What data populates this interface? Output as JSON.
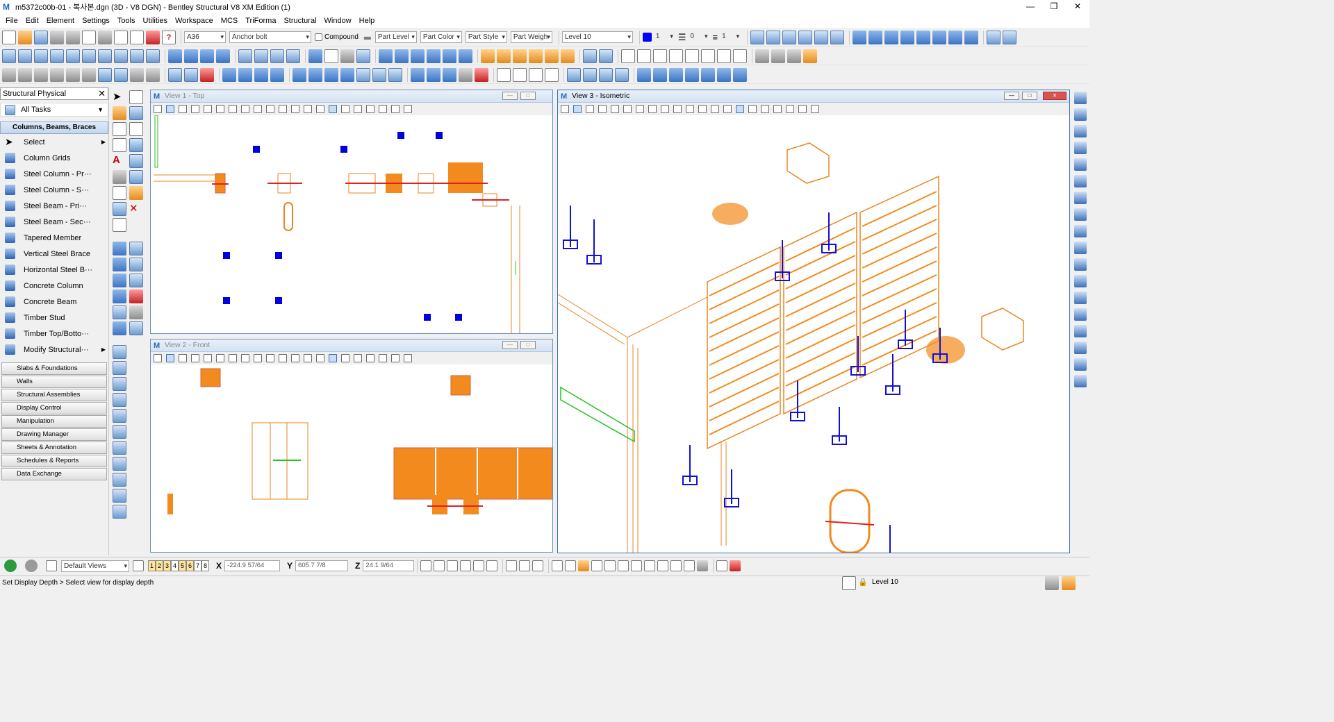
{
  "window": {
    "title": "m5372c00b-01 - 복사본.dgn (3D - V8 DGN) - Bentley Structural V8 XM Edition (1)",
    "app_icon_glyph": "M",
    "controls": [
      "—",
      "❐",
      "✕"
    ]
  },
  "menu": [
    "File",
    "Edit",
    "Element",
    "Settings",
    "Tools",
    "Utilities",
    "Workspace",
    "MCS",
    "TriForma",
    "Structural",
    "Window",
    "Help"
  ],
  "attributes_toolbar": {
    "material": "A36",
    "part": "Anchor bolt",
    "compound_label": "Compound",
    "part_level": "Part Level",
    "part_color": "Part Color",
    "part_style": "Part Style",
    "part_weight": "Part Weigh",
    "level": "Level 10",
    "color_value": "1",
    "style_value": "0",
    "weight_value": "1",
    "active_color": "#0000ff"
  },
  "task_panel": {
    "header": "Structural Physical",
    "close_glyph": "✕",
    "all_tasks": "All Tasks",
    "open_group": "Columns, Beams, Braces",
    "tools": [
      {
        "label": "Select",
        "icon": "arrow-select-icon"
      },
      {
        "label": "Column Grids",
        "icon": "column-grid-icon"
      },
      {
        "label": "Steel Column - Pr···",
        "icon": "steel-column-icon"
      },
      {
        "label": "Steel Column - S···",
        "icon": "steel-column-secondary-icon"
      },
      {
        "label": "Steel Beam - Pri···",
        "icon": "steel-beam-icon"
      },
      {
        "label": "Steel Beam - Sec···",
        "icon": "steel-beam-secondary-icon"
      },
      {
        "label": "Tapered Member",
        "icon": "tapered-member-icon"
      },
      {
        "label": "Vertical Steel Brace",
        "icon": "vertical-brace-icon"
      },
      {
        "label": "Horizontal Steel B···",
        "icon": "horizontal-brace-icon"
      },
      {
        "label": "Concrete Column",
        "icon": "concrete-column-icon"
      },
      {
        "label": "Concrete Beam",
        "icon": "concrete-beam-icon"
      },
      {
        "label": "Timber Stud",
        "icon": "timber-stud-icon"
      },
      {
        "label": "Timber Top/Botto···",
        "icon": "timber-plate-icon"
      },
      {
        "label": "Modify Structural···",
        "icon": "modify-structural-icon"
      }
    ],
    "groups": [
      "Slabs & Foundations",
      "Walls",
      "Structural Assemblies",
      "Display Control",
      "Manipulation",
      "Drawing Manager",
      "Sheets & Annotation",
      "Schedules & Reports",
      "Data Exchange"
    ]
  },
  "views": {
    "view1": {
      "title": "View 1 - Top"
    },
    "view2": {
      "title": "View 2 - Front"
    },
    "view3": {
      "title": "View 3 - Isometric"
    }
  },
  "bottom": {
    "default_views": "Default Views",
    "view_numbers": [
      "1",
      "2",
      "3",
      "4",
      "5",
      "6",
      "7",
      "8"
    ],
    "x_label": "X",
    "x_value": "-224.9 57/64",
    "y_label": "Y",
    "y_value": "605.7 7/8",
    "z_label": "Z",
    "z_value": "24.1 9/64"
  },
  "status": {
    "message": "Set Display Depth > Select view for display depth",
    "level": "Level 10"
  }
}
